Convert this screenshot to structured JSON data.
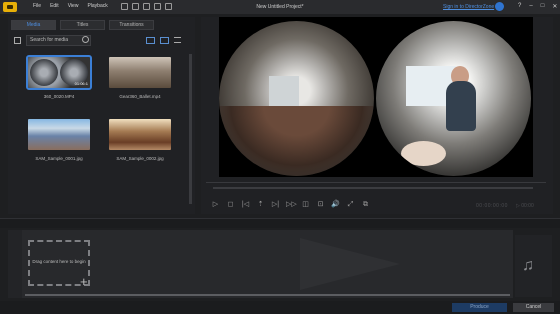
{
  "app": {
    "title": "New Untitled Project*",
    "menu": [
      "File",
      "Edit",
      "View",
      "Playback"
    ],
    "signin_label": "Sign in to DirectorZone",
    "window_controls": [
      "?",
      "–",
      "□",
      "✕"
    ]
  },
  "library": {
    "tabs": [
      {
        "label": "Media",
        "active": true
      },
      {
        "label": "Titles",
        "active": false
      },
      {
        "label": "Transitions",
        "active": false
      }
    ],
    "search_placeholder": "Search for media",
    "items": [
      {
        "label": "360_0020.MP4",
        "badge": "01:06:1",
        "selected": true
      },
      {
        "label": "Gear360_Ballet.mp4",
        "badge": "",
        "selected": false
      },
      {
        "label": "SAM_Sample_0001.jpg",
        "badge": "",
        "selected": false
      },
      {
        "label": "SAM_Sample_0002.jpg",
        "badge": "",
        "selected": false
      }
    ]
  },
  "preview": {
    "controls": [
      "▷",
      "◻",
      "|◁",
      "⇡",
      "▷|",
      "▷▷",
      "◫",
      "⊡",
      "🔊",
      "⤢",
      "⧉"
    ],
    "timecode": "00:00:00:00",
    "timecode2": "▷ 00:00"
  },
  "timeline": {
    "drop_text": "Drag content here to begin",
    "plus": "+"
  },
  "footer": {
    "produce_label": "Produce",
    "cancel_label": "Cancel"
  },
  "colors": {
    "accent": "#3b7fd6",
    "logo": "#e8b008",
    "background": "#1e1f21"
  }
}
